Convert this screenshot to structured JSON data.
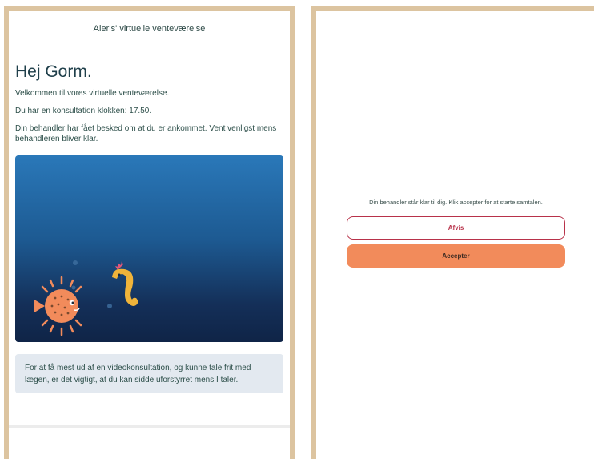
{
  "waiting_room": {
    "header_title": "Aleris' virtuelle venteværelse",
    "greeting": "Hej Gorm.",
    "welcome": "Velkommen til vores virtuelle venteværelse.",
    "appointment": "Du har en konsultation klokken: 17.50.",
    "notice": "Din behandler har fået besked om at du er ankommet. Vent venligst mens behandleren bliver klar.",
    "info": "For at få mest ud af en videokonsultation, og kunne tale frit med lægen, er det vigtigt, at du kan sidde uforstyrret mens I taler."
  },
  "call_prompt": {
    "message": "Din behandler står klar til dig. Klik accepter for at starte samtalen.",
    "reject_label": "Afvis",
    "accept_label": "Accepter"
  },
  "colors": {
    "frame": "#dcc4a0",
    "accept": "#f28b5b",
    "reject_border": "#b8324a",
    "water_top": "#2a78b9",
    "water_bottom": "#0f2447"
  },
  "icons": [
    "pufferfish-icon",
    "seahorse-icon",
    "bubble-icon"
  ]
}
